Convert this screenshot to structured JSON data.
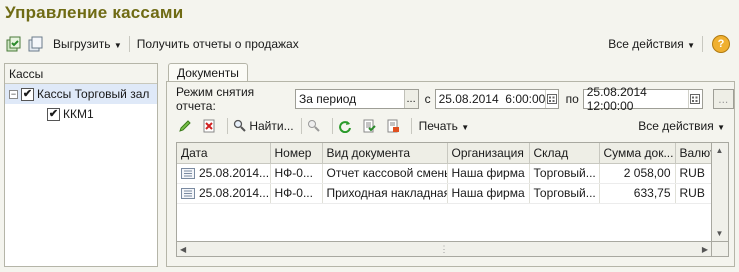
{
  "window": {
    "title": "Управление кассами"
  },
  "toolbar": {
    "export_label": "Выгрузить",
    "reports_label": "Получить отчеты о продажах",
    "all_actions_label": "Все действия",
    "help_label": "?"
  },
  "left_panel": {
    "title": "Кассы",
    "items": [
      {
        "label": "Кассы Торговый зал",
        "checked": true,
        "expander": "−"
      },
      {
        "label": "ККМ1",
        "checked": true
      }
    ]
  },
  "tab": {
    "label": "Документы"
  },
  "filter": {
    "mode_label": "Режим снятия отчета:",
    "mode_value": "За период",
    "from_label": "с",
    "from_value": "25.08.2014  6:00:00",
    "to_label": "по",
    "to_value": "25.08.2014 12:00:00",
    "dots": "..."
  },
  "doc_toolbar": {
    "find_label": "Найти...",
    "print_label": "Печать",
    "all_actions_label": "Все действия"
  },
  "grid": {
    "columns": [
      "Дата",
      "Номер",
      "Вид документа",
      "Организация",
      "Склад",
      "Сумма док...",
      "Валюта"
    ],
    "rows": [
      [
        "25.08.2014...",
        "НФ-0...",
        "Отчет кассовой смены",
        "Наша фирма",
        "Торговый...",
        "2 058,00",
        "RUB"
      ],
      [
        "25.08.2014...",
        "НФ-0...",
        "Приходная накладная",
        "Наша фирма",
        "Торговый...",
        "633,75",
        "RUB"
      ]
    ]
  },
  "colors": {
    "title": "#6f6b14",
    "accent": "#f0b030"
  }
}
